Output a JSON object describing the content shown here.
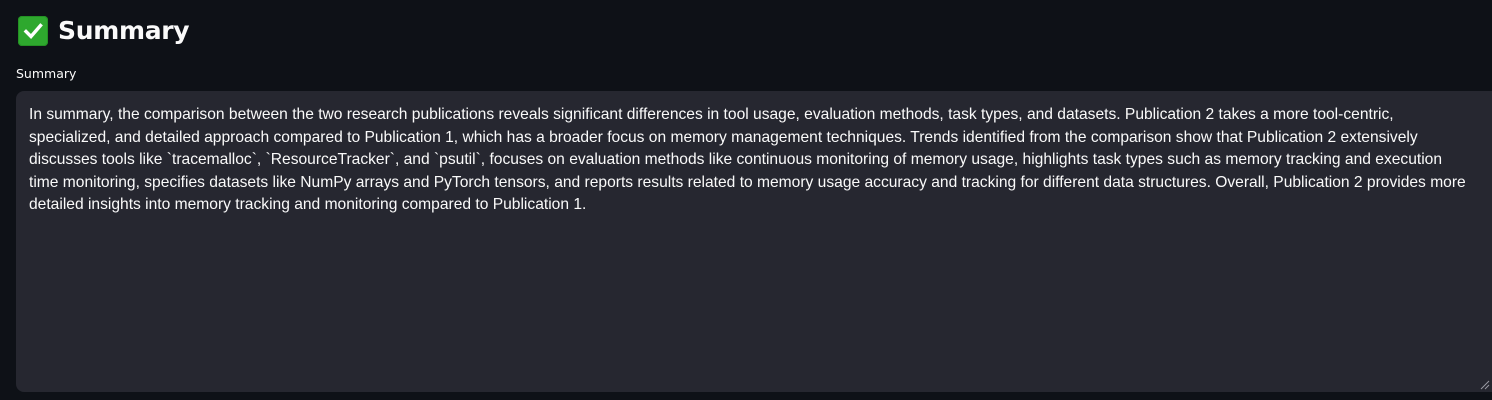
{
  "header": {
    "icon": "check-mark-icon",
    "title": "Summary"
  },
  "summary_field": {
    "label": "Summary",
    "value": "In summary, the comparison between the two research publications reveals significant differences in tool usage, evaluation methods, task types, and datasets. Publication 2 takes a more tool-centric, specialized, and detailed approach compared to Publication 1, which has a broader focus on memory management techniques. Trends identified from the comparison show that Publication 2 extensively discusses tools like `tracemalloc`, `ResourceTracker`, and `psutil`, focuses on evaluation methods like continuous monitoring of memory usage, highlights task types such as memory tracking and execution time monitoring, specifies datasets like NumPy arrays and PyTorch tensors, and reports results related to memory usage accuracy and tracking for different data structures. Overall, Publication 2 provides more detailed insights into memory tracking and monitoring compared to Publication 1."
  },
  "colors": {
    "background": "#0e1117",
    "textarea_background": "#262730",
    "check_green": "#2ea82e",
    "text": "#fafafa"
  }
}
